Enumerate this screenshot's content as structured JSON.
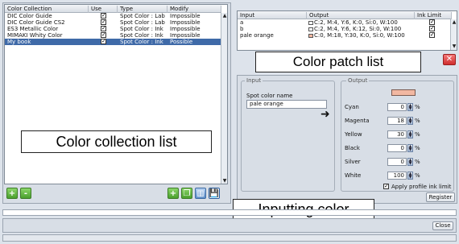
{
  "collection": {
    "columns": [
      "Color Collection",
      "Use",
      "Type",
      "Modify"
    ],
    "rows": [
      {
        "name": "DIC Color Guide",
        "use": "✓",
        "type": "Spot Color : Lab",
        "modify": "Impossible"
      },
      {
        "name": "DIC Color Guide CS2",
        "use": "✓",
        "type": "Spot Color : Lab",
        "modify": "Impossible"
      },
      {
        "name": "ES3 Metallic Color",
        "use": "✓",
        "type": "Spot Color : Ink",
        "modify": "Impossible"
      },
      {
        "name": "MIMAKI Whity Color",
        "use": "✓",
        "type": "Spot Color : Ink",
        "modify": "Impossible"
      },
      {
        "name": "My book",
        "use": "✓",
        "type": "Spot Color : Ink",
        "modify": "Possible"
      }
    ],
    "selected_index": 4,
    "add_icon": "+",
    "remove_icon": "-"
  },
  "patch_list": {
    "columns": [
      "Input",
      "Output",
      "Ink Limit"
    ],
    "rows": [
      {
        "input": "a",
        "output": "C:2, M:4, Y:6, K:0, Si:0, W:100",
        "ink_limit": "✓",
        "swatch": "#ffffff"
      },
      {
        "input": "b",
        "output": "C:2, M:4, Y:6, K:12, Si:0, W:100",
        "ink_limit": "✓",
        "swatch": "#ffffff"
      },
      {
        "input": "pale orange",
        "output": "C:0, M:18, Y:30, K:0, Si:0, W:100",
        "ink_limit": "✓",
        "swatch": "#f2b8a2"
      }
    ],
    "delete_icon": "✕"
  },
  "input_panel": {
    "input_group_label": "Input",
    "output_group_label": "Output",
    "spot_color_name_label": "Spot color name",
    "spot_color_name_value": "pale orange",
    "arrow": "➜",
    "output_swatch_color": "#f2b8a2",
    "channels": [
      {
        "label": "Cyan",
        "value": "0",
        "unit": "%"
      },
      {
        "label": "Magenta",
        "value": "18",
        "unit": "%"
      },
      {
        "label": "Yellow",
        "value": "30",
        "unit": "%"
      },
      {
        "label": "Black",
        "value": "0",
        "unit": "%"
      },
      {
        "label": "Silver",
        "value": "0",
        "unit": "%"
      },
      {
        "label": "White",
        "value": "100",
        "unit": "%"
      }
    ],
    "apply_ink_limit_label": "Apply profile ink limit",
    "apply_ink_limit_checked": "✓",
    "register_label": "Register"
  },
  "bottom": {
    "close_label": "Close"
  },
  "callouts": {
    "patch_list": "Color patch list",
    "collection_list": "Color collection list",
    "inputting": "Inputting color"
  }
}
